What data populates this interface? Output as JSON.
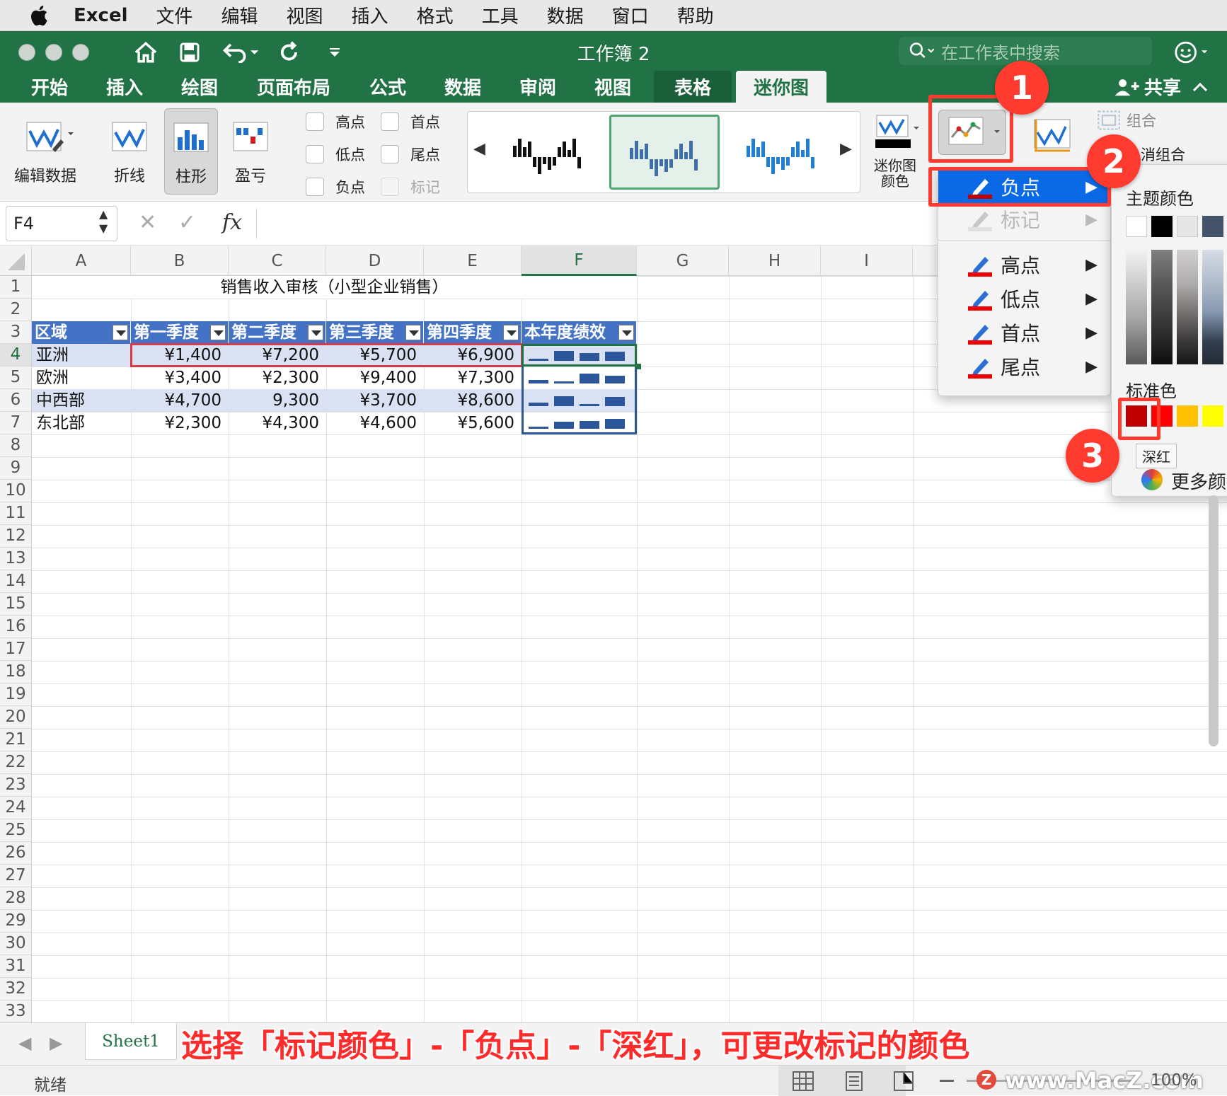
{
  "menubar": {
    "items": [
      "Excel",
      "文件",
      "编辑",
      "视图",
      "插入",
      "格式",
      "工具",
      "数据",
      "窗口",
      "帮助"
    ]
  },
  "window": {
    "title": "工作簿 2",
    "search_placeholder": "在工作表中搜索",
    "share_label": "共享"
  },
  "tabs": [
    "开始",
    "插入",
    "绘图",
    "页面布局",
    "公式",
    "数据",
    "审阅",
    "视图",
    "表格",
    "迷你图"
  ],
  "active_tab": "迷你图",
  "ribbon": {
    "edit_data": "编辑数据",
    "line": "折线",
    "column": "柱形",
    "win_loss": "盈亏",
    "checkboxes": {
      "high": "高点",
      "first": "首点",
      "low": "低点",
      "last": "尾点",
      "negative": "负点",
      "markers": "标记"
    },
    "sparkline_color": "迷你图颜色",
    "group": "组合",
    "ungroup": "消组合"
  },
  "formula_bar": {
    "name_box": "F4",
    "fx": "fx"
  },
  "columns": [
    "A",
    "B",
    "C",
    "D",
    "E",
    "F",
    "G",
    "H",
    "I"
  ],
  "rows": [
    "1",
    "2",
    "3",
    "4",
    "5",
    "6",
    "7",
    "8",
    "9",
    "10",
    "11",
    "12",
    "13",
    "14",
    "15",
    "16",
    "17",
    "18",
    "19",
    "20",
    "21",
    "22",
    "23",
    "24",
    "25",
    "26",
    "27",
    "28",
    "29",
    "30",
    "31",
    "32",
    "33"
  ],
  "sheet": {
    "title": "销售收入审核（小型企业销售）",
    "table_headers": [
      "区域",
      "第一季度",
      "第二季度",
      "第三季度",
      "第四季度",
      "本年度绩效"
    ],
    "table_rows": [
      {
        "region": "亚洲",
        "q1": "¥1,400",
        "q2": "¥7,200",
        "q3": "¥5,700",
        "q4": "¥6,900"
      },
      {
        "region": "欧洲",
        "q1": "¥3,400",
        "q2": "¥2,300",
        "q3": "¥9,400",
        "q4": "¥7,300"
      },
      {
        "region": "中西部",
        "q1": "¥4,700",
        "q2": "9,300",
        "q3": "¥3,700",
        "q4": "¥8,600"
      },
      {
        "region": "东北部",
        "q1": "¥2,300",
        "q2": "¥4,300",
        "q3": "¥4,600",
        "q4": "¥5,600"
      }
    ]
  },
  "marker_menu": {
    "items": [
      {
        "label": "负点",
        "state": "highlighted"
      },
      {
        "label": "标记",
        "state": "disabled"
      },
      {
        "label": "高点",
        "state": "normal"
      },
      {
        "label": "低点",
        "state": "normal"
      },
      {
        "label": "首点",
        "state": "normal"
      },
      {
        "label": "尾点",
        "state": "normal"
      }
    ]
  },
  "palette": {
    "theme_colors_label": "主题颜色",
    "standard_colors_label": "标准色",
    "tooltip": "深红",
    "more_colors": "更多颜",
    "standard_colors": [
      "#c00000",
      "#ff0000",
      "#ffc000",
      "#ffff00"
    ],
    "theme_top": [
      "#ffffff",
      "#000000",
      "#e7e6e6",
      "#44546a"
    ]
  },
  "steps": [
    "1",
    "2",
    "3"
  ],
  "sheet_tab": "Sheet1",
  "status": "就绪",
  "zoom": "100%",
  "caption": "选择「标记颜色」-「负点」-「深红」，可更改标记的颜色",
  "watermark": "www.MacZ.com",
  "colors": {
    "excel_green": "#217346",
    "table_header": "#4472c4",
    "band": "#d9e1f2",
    "highlight": "#0a6ae6",
    "callout": "#ff3b30"
  }
}
